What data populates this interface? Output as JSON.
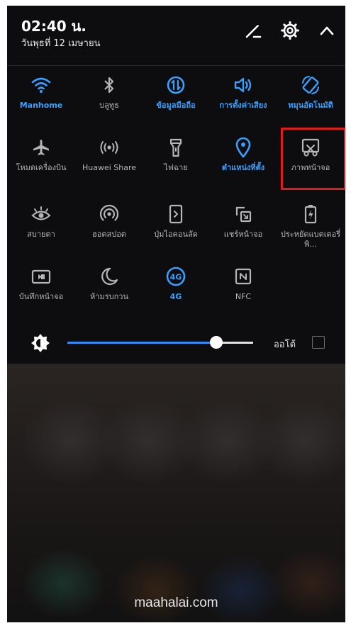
{
  "status": {
    "time": "02:40 น.",
    "date": "วันพุธที่ 12 เมษายน"
  },
  "header_icons": [
    "edit-icon",
    "settings-icon",
    "chevron-up-icon"
  ],
  "colors": {
    "accent": "#3aa0ff",
    "inactive": "#b5b5b8",
    "highlight": "#e01b1b",
    "background": "#0d0d0f"
  },
  "tiles": [
    {
      "label": "Manhome",
      "icon": "wifi-icon",
      "active": true
    },
    {
      "label": "บลูทูธ",
      "icon": "bluetooth-icon",
      "active": false
    },
    {
      "label": "ข้อมูลมือถือ",
      "icon": "mobile-data-icon",
      "active": true
    },
    {
      "label": "การตั้งค่าเสียง",
      "icon": "sound-icon",
      "active": true
    },
    {
      "label": "หมุนอัตโนมัติ",
      "icon": "auto-rotate-icon",
      "active": true
    },
    {
      "label": "โหมดเครื่องบิน",
      "icon": "airplane-icon",
      "active": false
    },
    {
      "label": "Huawei Share",
      "icon": "huawei-share-icon",
      "active": false
    },
    {
      "label": "ไฟฉาย",
      "icon": "flashlight-icon",
      "active": false
    },
    {
      "label": "ตำแหน่งที่ตั้ง",
      "icon": "location-icon",
      "active": true
    },
    {
      "label": "ภาพหน้าจอ",
      "icon": "screenshot-icon",
      "active": false
    },
    {
      "label": "สบายตา",
      "icon": "eye-comfort-icon",
      "active": false
    },
    {
      "label": "ฮอตสปอต",
      "icon": "hotspot-icon",
      "active": false
    },
    {
      "label": "ปุ่มไอคอนลัด",
      "icon": "shortcut-button-icon",
      "active": false
    },
    {
      "label": "แชร์หน้าจอ",
      "icon": "screen-share-icon",
      "active": false
    },
    {
      "label": "ประหยัดแบตเตอรี่พิ...",
      "icon": "battery-saver-icon",
      "active": false
    },
    {
      "label": "บันทึกหน้าจอ",
      "icon": "screen-record-icon",
      "active": false
    },
    {
      "label": "ห้ามรบกวน",
      "icon": "do-not-disturb-icon",
      "active": false
    },
    {
      "label": "4G",
      "icon": "4g-icon",
      "active": true
    },
    {
      "label": "NFC",
      "icon": "nfc-icon",
      "active": false
    }
  ],
  "brightness": {
    "level": 0.8,
    "auto_label": "ออโต้",
    "auto_checked": false,
    "icon": "brightness-icon"
  },
  "watermark": "maahalai.com"
}
